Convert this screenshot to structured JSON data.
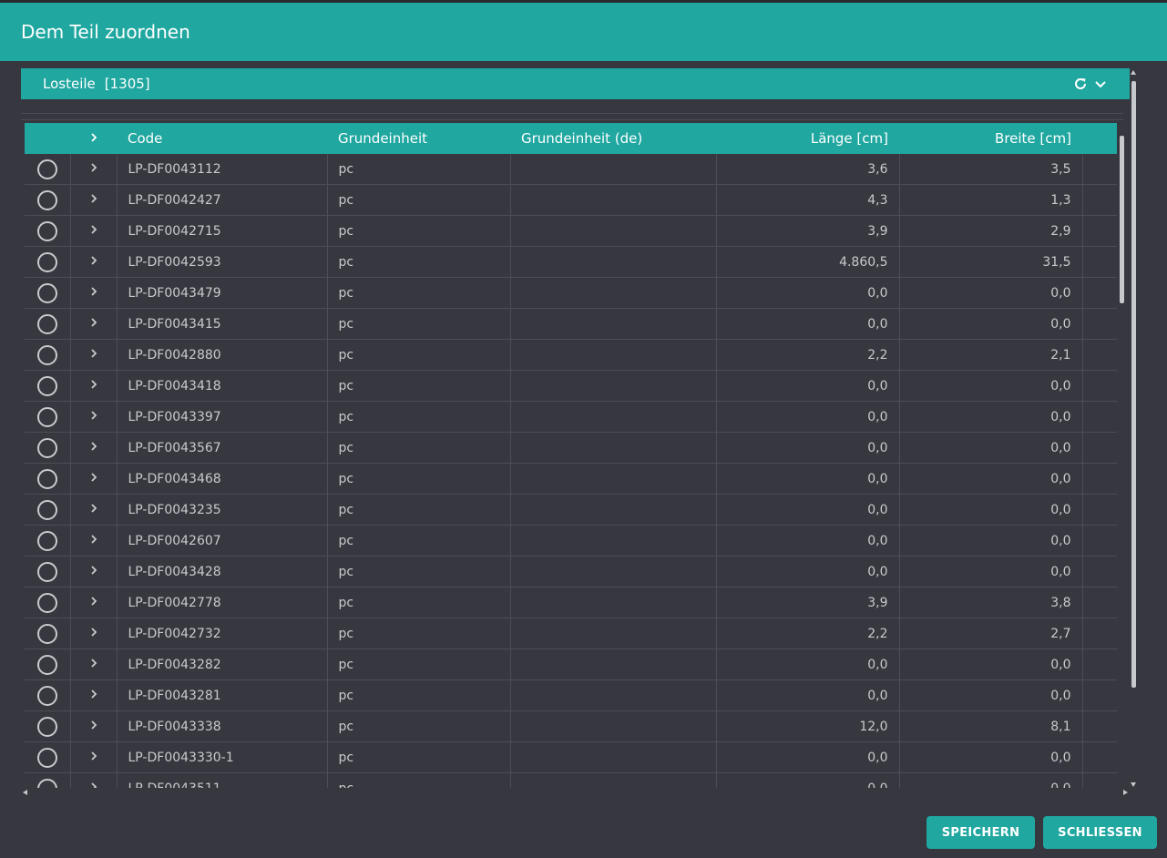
{
  "dialog": {
    "title": "Dem Teil zuordnen"
  },
  "section": {
    "title": "Losteile",
    "count": "[1305]",
    "icons": [
      "refresh-icon",
      "chevron-down-icon"
    ]
  },
  "table": {
    "headers": {
      "code": "Code",
      "grundeinheit": "Grundeinheit",
      "grundeinheit_de": "Grundeinheit (de)",
      "laenge": "Länge [cm]",
      "breite": "Breite [cm]"
    },
    "rows": [
      {
        "code": "LP-DF0043112",
        "unit": "pc",
        "unit_de": "",
        "laenge": "3,6",
        "breite": "3,5"
      },
      {
        "code": "LP-DF0042427",
        "unit": "pc",
        "unit_de": "",
        "laenge": "4,3",
        "breite": "1,3"
      },
      {
        "code": "LP-DF0042715",
        "unit": "pc",
        "unit_de": "",
        "laenge": "3,9",
        "breite": "2,9"
      },
      {
        "code": "LP-DF0042593",
        "unit": "pc",
        "unit_de": "",
        "laenge": "4.860,5",
        "breite": "31,5"
      },
      {
        "code": "LP-DF0043479",
        "unit": "pc",
        "unit_de": "",
        "laenge": "0,0",
        "breite": "0,0"
      },
      {
        "code": "LP-DF0043415",
        "unit": "pc",
        "unit_de": "",
        "laenge": "0,0",
        "breite": "0,0"
      },
      {
        "code": "LP-DF0042880",
        "unit": "pc",
        "unit_de": "",
        "laenge": "2,2",
        "breite": "2,1"
      },
      {
        "code": "LP-DF0043418",
        "unit": "pc",
        "unit_de": "",
        "laenge": "0,0",
        "breite": "0,0"
      },
      {
        "code": "LP-DF0043397",
        "unit": "pc",
        "unit_de": "",
        "laenge": "0,0",
        "breite": "0,0"
      },
      {
        "code": "LP-DF0043567",
        "unit": "pc",
        "unit_de": "",
        "laenge": "0,0",
        "breite": "0,0"
      },
      {
        "code": "LP-DF0043468",
        "unit": "pc",
        "unit_de": "",
        "laenge": "0,0",
        "breite": "0,0"
      },
      {
        "code": "LP-DF0043235",
        "unit": "pc",
        "unit_de": "",
        "laenge": "0,0",
        "breite": "0,0"
      },
      {
        "code": "LP-DF0042607",
        "unit": "pc",
        "unit_de": "",
        "laenge": "0,0",
        "breite": "0,0"
      },
      {
        "code": "LP-DF0043428",
        "unit": "pc",
        "unit_de": "",
        "laenge": "0,0",
        "breite": "0,0"
      },
      {
        "code": "LP-DF0042778",
        "unit": "pc",
        "unit_de": "",
        "laenge": "3,9",
        "breite": "3,8"
      },
      {
        "code": "LP-DF0042732",
        "unit": "pc",
        "unit_de": "",
        "laenge": "2,2",
        "breite": "2,7"
      },
      {
        "code": "LP-DF0043282",
        "unit": "pc",
        "unit_de": "",
        "laenge": "0,0",
        "breite": "0,0"
      },
      {
        "code": "LP-DF0043281",
        "unit": "pc",
        "unit_de": "",
        "laenge": "0,0",
        "breite": "0,0"
      },
      {
        "code": "LP-DF0043338",
        "unit": "pc",
        "unit_de": "",
        "laenge": "12,0",
        "breite": "8,1"
      },
      {
        "code": "LP-DF0043330-1",
        "unit": "pc",
        "unit_de": "",
        "laenge": "0,0",
        "breite": "0,0"
      },
      {
        "code": "LP-DF0043511",
        "unit": "pc",
        "unit_de": "",
        "laenge": "0,0",
        "breite": "0,0"
      }
    ]
  },
  "buttons": {
    "save": "SPEICHERN",
    "close": "SCHLIESSEN"
  },
  "colors": {
    "accent": "#20a7a0",
    "background": "#36373f",
    "gridline": "#4c4d55",
    "text": "#c9cace"
  }
}
